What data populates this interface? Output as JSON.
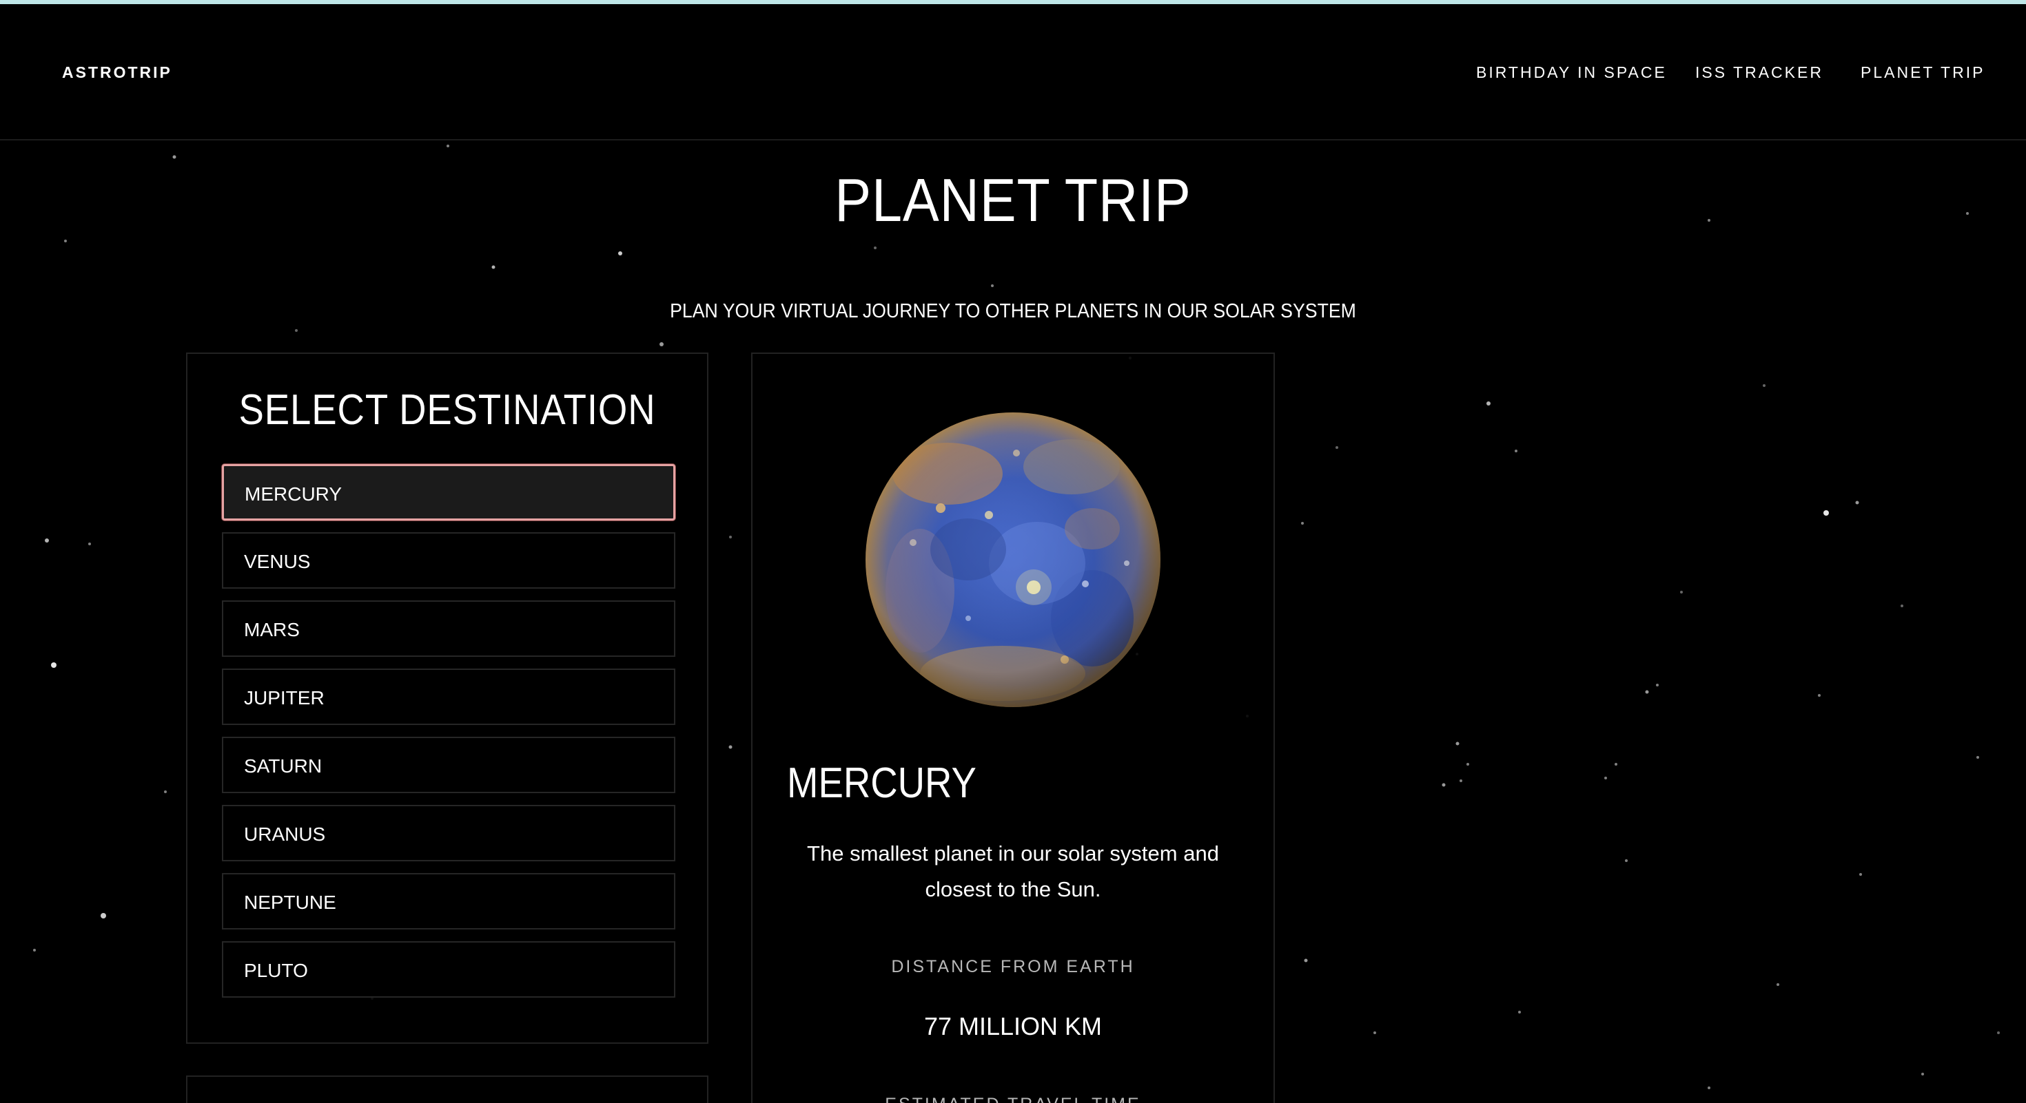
{
  "brand": "ASTROTRIP",
  "nav": {
    "items": [
      "BIRTHDAY IN SPACE",
      "ISS TRACKER",
      "PLANET TRIP"
    ]
  },
  "page": {
    "title": "PLANET TRIP",
    "subtitle": "PLAN YOUR VIRTUAL JOURNEY TO OTHER PLANETS IN OUR SOLAR SYSTEM"
  },
  "destinations": {
    "heading": "SELECT DESTINATION",
    "selected": "MERCURY",
    "items": [
      "MERCURY",
      "VENUS",
      "MARS",
      "JUPITER",
      "SATURN",
      "URANUS",
      "NEPTUNE",
      "PLUTO"
    ]
  },
  "planet": {
    "name": "MERCURY",
    "description": "The smallest planet in our solar system and closest to the Sun.",
    "distance_label": "DISTANCE FROM EARTH",
    "distance_value": "77 MILLION KM",
    "travel_label": "ESTIMATED TRAVEL TIME"
  },
  "colors": {
    "background": "#000000",
    "top_accent": "#bfe6e8",
    "selected_border": "#e6a3a3",
    "muted_text": "#b8b8b8"
  }
}
